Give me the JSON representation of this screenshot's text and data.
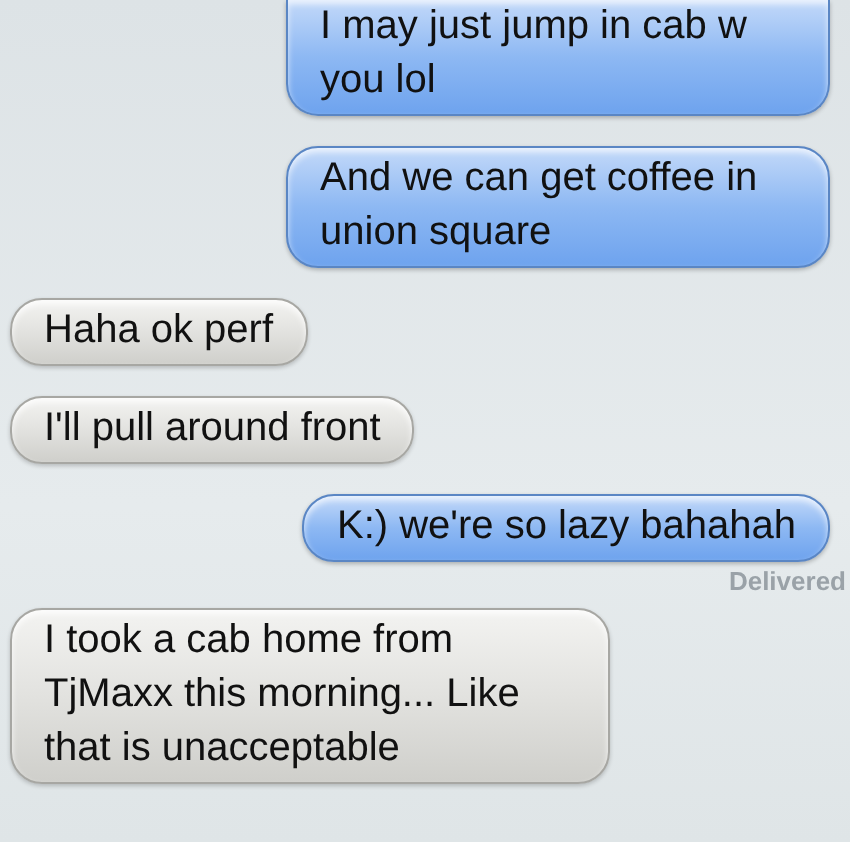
{
  "messages": [
    {
      "kind": "sent",
      "text": "I may just jump in cab w you lol"
    },
    {
      "kind": "sent",
      "text": "And we can get coffee in union square"
    },
    {
      "kind": "received",
      "text": "Haha ok perf"
    },
    {
      "kind": "received",
      "text": "I'll pull around front"
    },
    {
      "kind": "sent",
      "text": "K:) we're so lazy bahahah"
    },
    {
      "kind": "status",
      "text": "Delivered"
    },
    {
      "kind": "received",
      "text": "I took a cab home from TjMaxx this morning... Like that is unacceptable"
    }
  ]
}
